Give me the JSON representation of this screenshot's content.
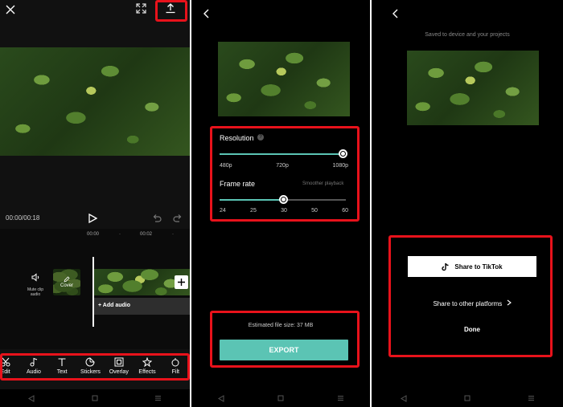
{
  "editor": {
    "time_readout": "00:00/00:18",
    "ruler": [
      "00:00",
      "00:02"
    ],
    "mute_label": "Mute clip audio",
    "cover_label": "Cover",
    "add_audio_label": "+ Add audio",
    "tools": [
      {
        "label": "Edit",
        "icon": "scissors-icon"
      },
      {
        "label": "Audio",
        "icon": "music-note-icon"
      },
      {
        "label": "Text",
        "icon": "text-icon"
      },
      {
        "label": "Stickers",
        "icon": "sticker-icon"
      },
      {
        "label": "Overlay",
        "icon": "overlay-icon"
      },
      {
        "label": "Effects",
        "icon": "effects-icon"
      },
      {
        "label": "Filt",
        "icon": "filter-icon"
      }
    ]
  },
  "export_settings": {
    "resolution_label": "Resolution",
    "resolution_ticks": [
      "480p",
      "720p",
      "1080p"
    ],
    "resolution_value": "1080p",
    "frame_rate_label": "Frame rate",
    "frame_rate_hint": "Smoother playback",
    "frame_rate_ticks": [
      "24",
      "25",
      "30",
      "50",
      "60"
    ],
    "frame_rate_value": "30",
    "file_size": "Estimated file size: 37 MB",
    "export_label": "EXPORT",
    "accent": "#5bc4b4"
  },
  "share": {
    "saved_text": "Saved to device and your projects",
    "tiktok_label": "Share to TikTok",
    "other_label": "Share to other platforms",
    "done_label": "Done"
  },
  "highlight_color": "#e8121b"
}
